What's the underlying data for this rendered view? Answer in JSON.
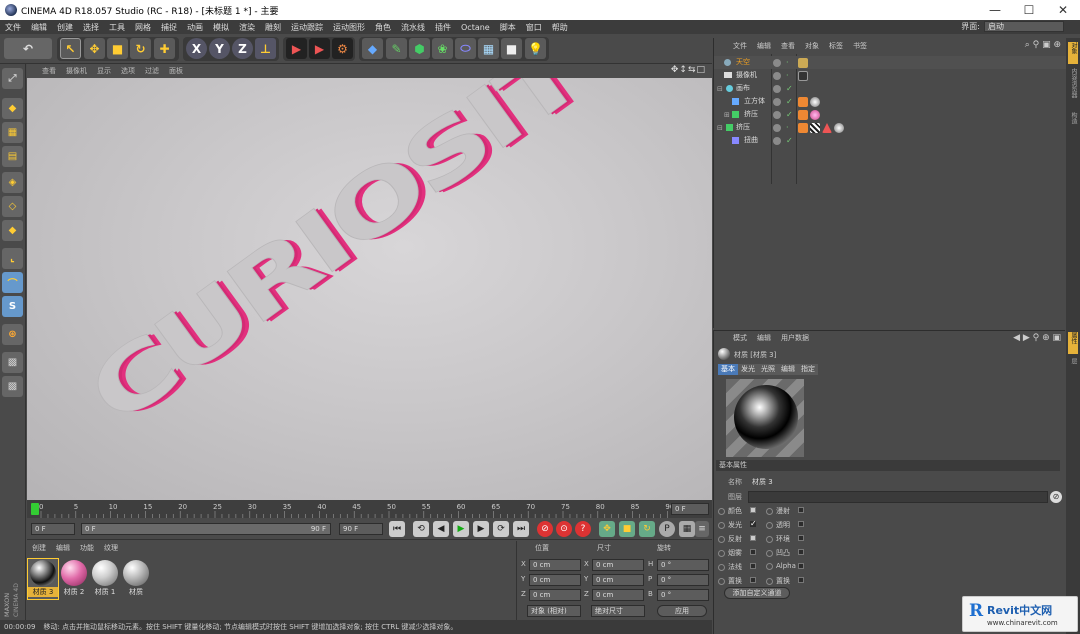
{
  "window": {
    "title": "CINEMA 4D R18.057 Studio (RC - R18) - [未标题 1 *] - 主要"
  },
  "menu": [
    "文件",
    "编辑",
    "创建",
    "选择",
    "工具",
    "网格",
    "捕捉",
    "动画",
    "模拟",
    "渲染",
    "雕刻",
    "运动跟踪",
    "运动图形",
    "角色",
    "流水线",
    "插件",
    "Octane",
    "脚本",
    "窗口",
    "帮助"
  ],
  "layout": {
    "label": "界面:",
    "value": "启动"
  },
  "viewport": {
    "menu": [
      "查看",
      "摄像机",
      "显示",
      "选项",
      "过滤",
      "面板"
    ],
    "nav_icons": "✥↕⇆□",
    "scene_text": "CURIOSITY"
  },
  "timeline": {
    "ticks": [
      "0",
      "5",
      "10",
      "15",
      "20",
      "25",
      "30",
      "35",
      "40",
      "45",
      "50",
      "55",
      "60",
      "65",
      "70",
      "75",
      "80",
      "85",
      "90"
    ],
    "current": "0 F"
  },
  "transport": {
    "start": "0 F",
    "range_start": "0 F",
    "range_end": "90 F",
    "end": "90 F"
  },
  "materials": {
    "menu": [
      "创建",
      "编辑",
      "功能",
      "纹理"
    ],
    "items": [
      {
        "name": "材质 3",
        "color": "#d8d8d8"
      },
      {
        "name": "材质 2",
        "color": "#e06aa8"
      },
      {
        "name": "材质 1",
        "color": "#cfcfcf"
      },
      {
        "name": "材质",
        "color": "#bdbdbd"
      }
    ]
  },
  "coords": {
    "headers": [
      "位置",
      "尺寸",
      "旋转"
    ],
    "rows": [
      {
        "axis": "X",
        "pos": "0 cm",
        "size_axis": "X",
        "size": "0 cm",
        "rot_axis": "H",
        "rot": "0 °"
      },
      {
        "axis": "Y",
        "pos": "0 cm",
        "size_axis": "Y",
        "size": "0 cm",
        "rot_axis": "P",
        "rot": "0 °"
      },
      {
        "axis": "Z",
        "pos": "0 cm",
        "size_axis": "Z",
        "size": "0 cm",
        "rot_axis": "B",
        "rot": "0 °"
      }
    ],
    "mode": "对象 (相对)",
    "size_mode": "绝对尺寸",
    "apply": "应用"
  },
  "statusbar": {
    "time": "00:00:09",
    "message": "移动: 点击并拖动鼠标移动元素。按住 SHIFT 键量化移动; 节点编辑模式时按住 SHIFT 键增加选择对象; 按住 CTRL 键减少选择对象。"
  },
  "objects": {
    "menu": [
      "文件",
      "编辑",
      "查看",
      "对象",
      "标签",
      "书签"
    ],
    "rows": [
      {
        "name": "天空",
        "highlight": true
      },
      {
        "name": "摄像机",
        "highlight": false
      },
      {
        "name": "画布",
        "highlight": false
      },
      {
        "name": "立方体",
        "highlight": false
      },
      {
        "name": "挤压",
        "highlight": false
      },
      {
        "name": "挤压",
        "highlight": false
      },
      {
        "name": "扭曲",
        "highlight": false
      }
    ]
  },
  "attributes": {
    "menu": [
      "模式",
      "编辑",
      "用户数据"
    ],
    "title": "材质 [材质 3]",
    "tabs": [
      "基本",
      "发光",
      "光照",
      "编辑",
      "指定"
    ],
    "section": "基本属性",
    "name_label": "名称",
    "name_value": "材质 3",
    "layer_label": "图层",
    "channels_left": [
      "颜色",
      "发光",
      "反射",
      "烟雾",
      "法线",
      "置换"
    ],
    "channels_right": [
      "漫射",
      "透明",
      "环境",
      "凹凸",
      "Alpha",
      "置换"
    ],
    "add_button": "添加自定义通道"
  },
  "logo": {
    "vertical": "MAXON CINEMA 4D"
  },
  "watermark": {
    "brand": "Revit中文网",
    "url": "www.chinarevit.com"
  },
  "right_strip": [
    "对象",
    "内容浏览器",
    "构造",
    "属性",
    "层"
  ]
}
